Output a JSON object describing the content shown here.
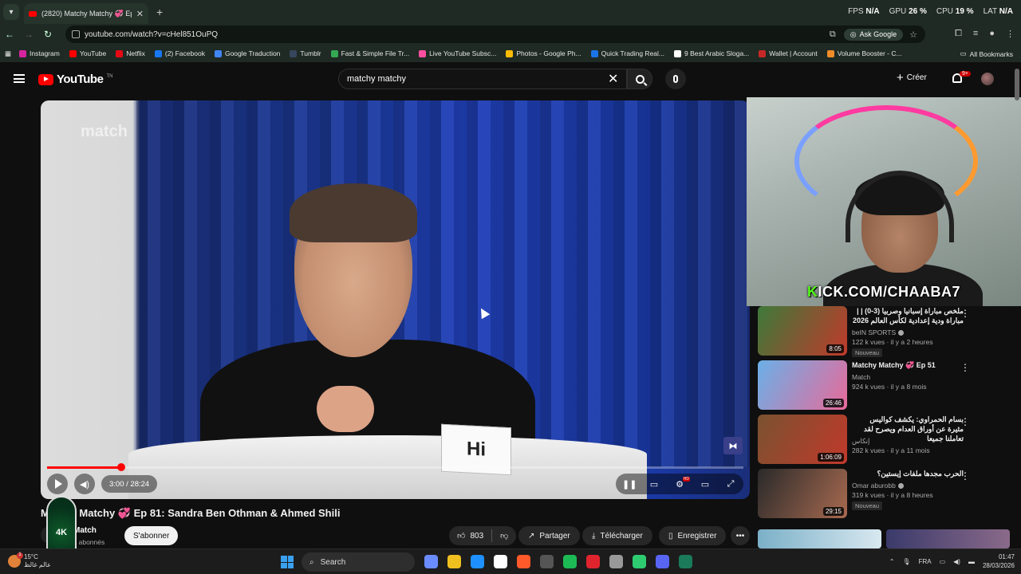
{
  "browser": {
    "tab_title": "(2820) Matchy Matchy 💞 Ep 8",
    "url": "youtube.com/watch?v=cHel851OuPQ",
    "ask_google": "Ask Google",
    "perf": [
      {
        "label": "FPS",
        "value": "N/A"
      },
      {
        "label": "GPU",
        "value": "26 %"
      },
      {
        "label": "CPU",
        "value": "19 %"
      },
      {
        "label": "LAT",
        "value": "N/A"
      }
    ],
    "bookmarks": [
      {
        "label": "Instagram",
        "color": "#d6249f"
      },
      {
        "label": "YouTube",
        "color": "#ff0000"
      },
      {
        "label": "Netflix",
        "color": "#e50914"
      },
      {
        "label": "(2) Facebook",
        "color": "#1877f2"
      },
      {
        "label": "Google Traduction",
        "color": "#4285f4"
      },
      {
        "label": "Tumblr",
        "color": "#36465d"
      },
      {
        "label": "Fast & Simple File Tr...",
        "color": "#34a853"
      },
      {
        "label": "Live YouTube Subsc...",
        "color": "#ff4fa0"
      },
      {
        "label": "Photos - Google Ph...",
        "color": "#fbbc05"
      },
      {
        "label": "Quick Trading Real...",
        "color": "#1a73e8"
      },
      {
        "label": "9 Best Arabic Sloga...",
        "color": "#ffffff"
      },
      {
        "label": "Wallet | Account",
        "color": "#c62828"
      },
      {
        "label": "Volume Booster - C...",
        "color": "#f28c28"
      }
    ],
    "all_bookmarks": "All Bookmarks"
  },
  "youtube": {
    "logo_text": "YouTube",
    "logo_tm": "TN",
    "search_value": "matchy matchy",
    "create_label": "Créer",
    "notif_badge": "9+"
  },
  "player": {
    "watermark": "match",
    "card_text": "Hi",
    "time": "3:00 / 28:24",
    "progress_fraction": 0.106,
    "hd_badge": "HD"
  },
  "webcam": {
    "kick_k": "K",
    "kick_rest": "ICK.COM/CHAABA7"
  },
  "video": {
    "title": "Matchy Matchy 💞 Ep 81: Sandra Ben Othman & Ahmed Shili",
    "channel": "Match",
    "subs": "k abonnés",
    "subscribe": "S'abonner",
    "likes": "803",
    "share": "Partager",
    "download": "Télécharger",
    "save": "Enregistrer"
  },
  "badge_ak": "4K",
  "recommendations": [
    {
      "title": "ملخص مباراة إسبانيا وصربيا (3-0) | | مباراة ودية إعدادية لكأس العالم 2026",
      "rtl": true,
      "channel": "beIN SPORTS",
      "verified": true,
      "meta": "122 k vues · il y a 2 heures",
      "tag": "Nouveau",
      "duration": "8:05",
      "thumb": [
        "#3d7a3a",
        "#c0392b"
      ]
    },
    {
      "title": "Matchy Matchy 💞 Ep 51",
      "rtl": false,
      "channel": "Match",
      "verified": false,
      "meta": "924 k vues · il y a 8 mois",
      "tag": "",
      "duration": "26:46",
      "thumb": [
        "#6ab0e8",
        "#e86a9a"
      ]
    },
    {
      "title": "بسام الحمراوي: يكشف كواليس مثيرة عن أوراق العدام ويصرح لقد تعاملنا جميعا",
      "rtl": true,
      "channel": "إنكاس",
      "verified": false,
      "meta": "282 k vues · il y a 11 mois",
      "tag": "",
      "duration": "1:06:09",
      "thumb": [
        "#7a5230",
        "#c0392b"
      ]
    },
    {
      "title": "الحرب مجدها ملفات إيستين؟",
      "rtl": true,
      "channel": "Omar aburobb",
      "verified": true,
      "meta": "319 k vues · il y a 8 heures",
      "tag": "Nouveau",
      "duration": "29:15",
      "thumb": [
        "#2a2a2a",
        "#a86a50"
      ]
    }
  ],
  "taskbar": {
    "temp": "15°C",
    "weather_sub": "عالم غالظ",
    "weather_badge": "1",
    "search": "Search",
    "lang": "FRA",
    "time": "01:47",
    "date": "28/03/2026",
    "apps": [
      "#6b8cff",
      "#f0c020",
      "#1e90ff",
      "#ffffff",
      "#ff5a2a",
      "#555555",
      "#1db954",
      "#e0242e",
      "#999999",
      "#2ecc71",
      "#5865f2",
      "#1a7a5a"
    ]
  }
}
